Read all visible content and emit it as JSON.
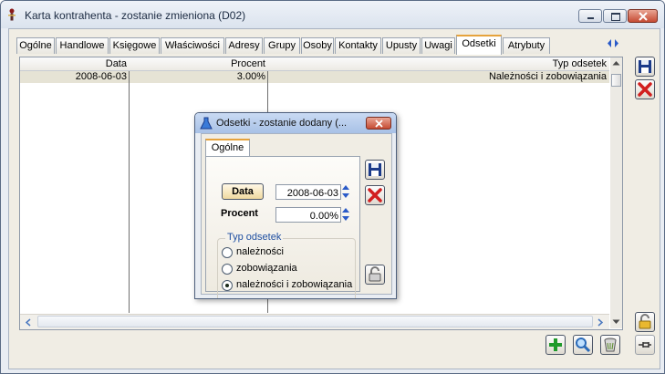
{
  "window": {
    "title": "Karta kontrahenta - zostanie zmieniona (D02)"
  },
  "tabs": [
    {
      "label": "Ogólne"
    },
    {
      "label": "Handlowe"
    },
    {
      "label": "Księgowe"
    },
    {
      "label": "Właściwości"
    },
    {
      "label": "Adresy"
    },
    {
      "label": "Grupy"
    },
    {
      "label": "Osoby"
    },
    {
      "label": "Kontakty"
    },
    {
      "label": "Upusty"
    },
    {
      "label": "Uwagi"
    },
    {
      "label": "Odsetki",
      "active": true
    },
    {
      "label": "Atrybuty"
    }
  ],
  "grid": {
    "columns": [
      "Data",
      "Procent",
      "Typ odsetek"
    ],
    "rows": [
      {
        "data": "2008-06-03",
        "procent": "3.00%",
        "typ": "Należności i zobowiązania"
      }
    ]
  },
  "dialog": {
    "title": "Odsetki - zostanie dodany  (...",
    "tab": "Ogólne",
    "data_button": "Data",
    "data_value": "2008-06-03",
    "procent_label": "Procent",
    "procent_value": "0.00%",
    "group_title": "Typ odsetek",
    "options": [
      {
        "label": "należności",
        "selected": false
      },
      {
        "label": "zobowiązania",
        "selected": false
      },
      {
        "label": "należności i zobowiązania",
        "selected": true
      }
    ]
  },
  "colors": {
    "active_tab_accent": "#e6a33c",
    "selected_row": "#e6e3d5",
    "cancel_red": "#d21f1f",
    "add_green": "#1f9a2a",
    "group_title_blue": "#1f4fa0"
  },
  "icons": {
    "save": "floppy-disk-icon",
    "cancel": "red-x-icon",
    "lock": "padlock-icon",
    "add": "green-plus-icon",
    "search": "magnifier-icon",
    "delete": "wastebasket-icon",
    "pin": "pushpin-icon"
  }
}
